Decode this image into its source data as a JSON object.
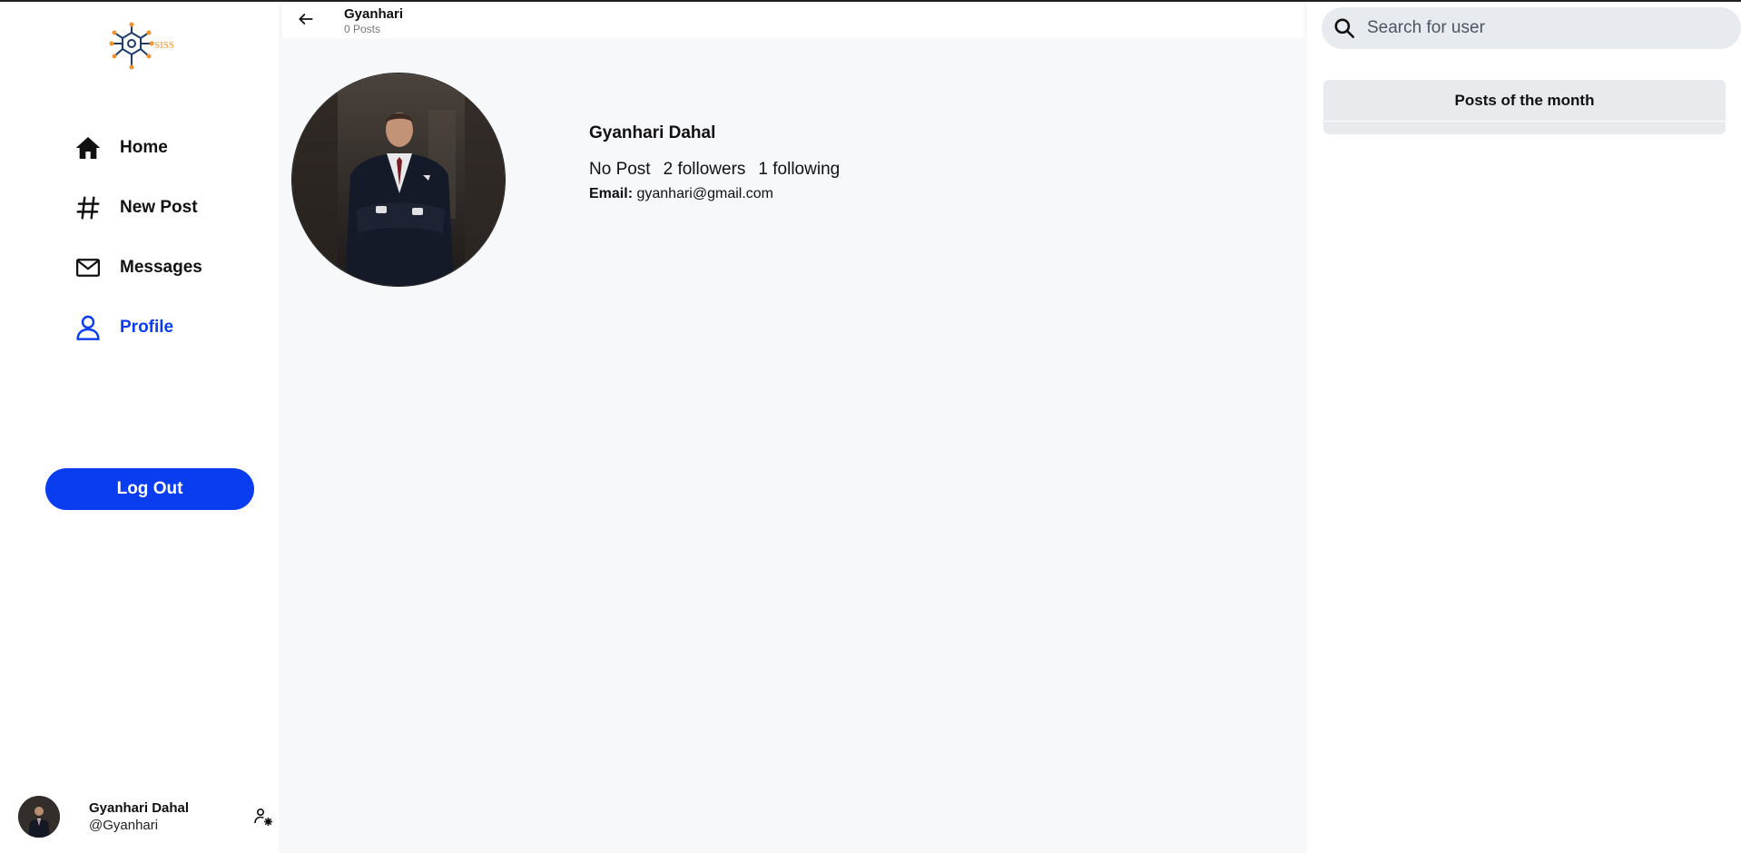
{
  "brand": {
    "logo_text": "SISS",
    "accent": "#0a3cf0",
    "logo_orange": "#f0922f",
    "logo_navy": "#1f3c6b"
  },
  "nav": {
    "items": [
      {
        "label": "Home",
        "icon": "home-icon"
      },
      {
        "label": "New Post",
        "icon": "hashtag-icon"
      },
      {
        "label": "Messages",
        "icon": "mail-icon"
      },
      {
        "label": "Profile",
        "icon": "user-icon",
        "active": true
      }
    ],
    "logout_label": "Log Out"
  },
  "current_user": {
    "name": "Gyanhari Dahal",
    "handle": "@Gyanhari",
    "settings_icon": "user-settings-icon"
  },
  "header": {
    "title": "Gyanhari",
    "subtitle": "0 Posts",
    "back_icon": "arrow-left-icon"
  },
  "profile": {
    "name": "Gyanhari Dahal",
    "posts": "No Post",
    "followers": "2 followers",
    "following": "1 following",
    "email_label": "Email:",
    "email": "gyanhari@gmail.com"
  },
  "search": {
    "placeholder": "Search for user",
    "icon": "search-icon"
  },
  "sidebar_right": {
    "posts_of_month_title": "Posts of the month"
  }
}
